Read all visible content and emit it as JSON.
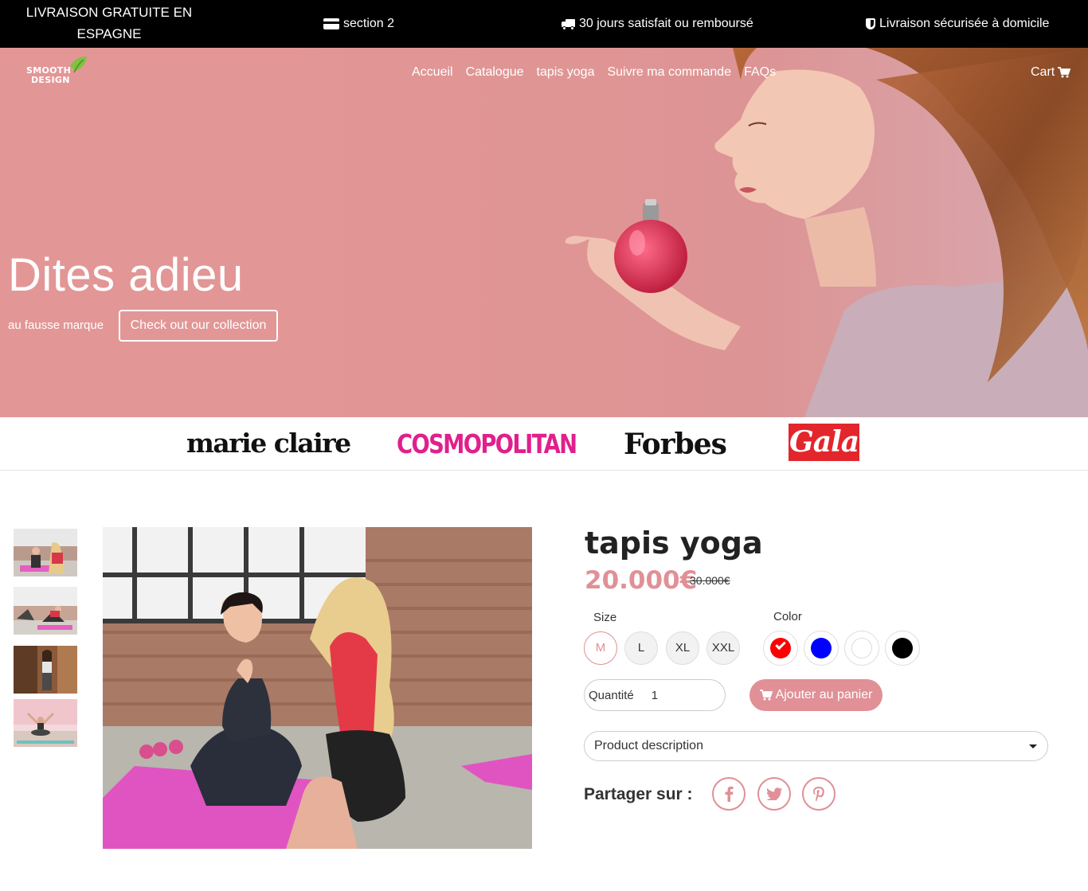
{
  "topbar": {
    "promo": "LIVRAISON GRATUITE EN ESPAGNE",
    "items": [
      {
        "icon": "credit-card-icon",
        "label": "section 2"
      },
      {
        "icon": "truck-icon",
        "label": "30 jours satisfait ou remboursé"
      },
      {
        "icon": "shield-icon",
        "label": "Livraison sécurisée à domicile"
      }
    ]
  },
  "header": {
    "logo_line1": "SMOOTH",
    "logo_line2": "DESIGN",
    "nav": [
      "Accueil",
      "Catalogue",
      "tapis yoga",
      "Suivre ma commande",
      "FAQs"
    ],
    "cart_label": "Cart"
  },
  "hero": {
    "title": "Dites adieu",
    "subtitle": "au fausse marque",
    "cta": "Check out our collection"
  },
  "press": [
    "marie claire",
    "COSMOPOLITAN",
    "Forbes",
    "Gala"
  ],
  "product": {
    "title": "tapis yoga",
    "price": "20.000€",
    "old_price": "30.000€",
    "size_label": "Size",
    "sizes": [
      "M",
      "L",
      "XL",
      "XXL"
    ],
    "selected_size": "M",
    "color_label": "Color",
    "colors": [
      "#ff0000",
      "#0000ff",
      "#ffffff",
      "#000000"
    ],
    "selected_color": "#ff0000",
    "quantity_label": "Quantité",
    "quantity_value": "1",
    "add_to_cart": "Ajouter au panier",
    "description_label": "Product description",
    "share_label": "Partager sur :",
    "share_icons": [
      "facebook-icon",
      "twitter-icon",
      "pinterest-icon"
    ]
  },
  "theme": {
    "accent": "#e09096",
    "hero_bg": "#e39696",
    "topbar_bg": "#000000"
  }
}
